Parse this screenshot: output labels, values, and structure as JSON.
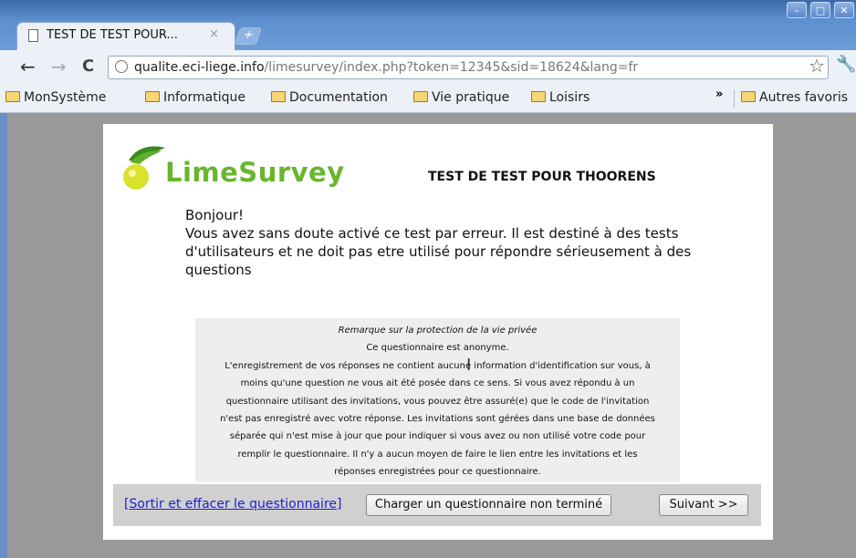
{
  "browser": {
    "tab_title": "TEST DE TEST POUR...",
    "tab_close": "×",
    "new_tab": "+",
    "window_buttons": [
      "–",
      "□",
      "✕"
    ],
    "nav": {
      "back": "←",
      "forward": "→",
      "reload": "C"
    },
    "url_host": "qualite.eci-liege.info",
    "url_rest": "/limesurvey/index.php?token=12345&sid=18624&lang=fr",
    "star": "☆",
    "wrench": "🔧",
    "bookmarks": [
      "MonSystème",
      "Informatique",
      "Documentation",
      "Vie pratique",
      "Loisirs"
    ],
    "bookmarks_more": "»",
    "other_bookmarks": "Autres favoris"
  },
  "survey": {
    "logo_text": "LimeSurvey",
    "title": "TEST DE TEST POUR THOORENS",
    "greeting": "Bonjour!",
    "description": "Vous avez sans doute activé ce test par erreur. Il est destiné à des tests d'utilisateurs et ne doit pas etre utilisé pour répondre sérieusement à des questions",
    "privacy": {
      "title": "Remarque sur la protection de la vie privée",
      "anonymous": "Ce questionnaire est anonyme.",
      "lines": [
        "L'enregistrement de vos réponses ne contient aucune information d'identification sur vous, à",
        "moins qu'une question ne vous ait été posée dans ce sens. Si vous avez répondu à un",
        "questionnaire utilisant des invitations, vous pouvez être assuré(e) que le code de l'invitation",
        "n'est pas enregistré avec votre réponse. Les invitations sont gérées dans une base de données",
        "séparée qui n'est mise à jour que pour indiquer si vous avez ou non utilisé votre code pour",
        "remplir le questionnaire. Il n'y a aucun moyen de faire le lien entre les invitations et les",
        "réponses enregistrées pour ce questionnaire."
      ]
    },
    "footer": {
      "exit_link": "[Sortir et effacer le questionnaire]",
      "load_button": "Charger un questionnaire non terminé",
      "next_button": "Suivant >>"
    }
  }
}
